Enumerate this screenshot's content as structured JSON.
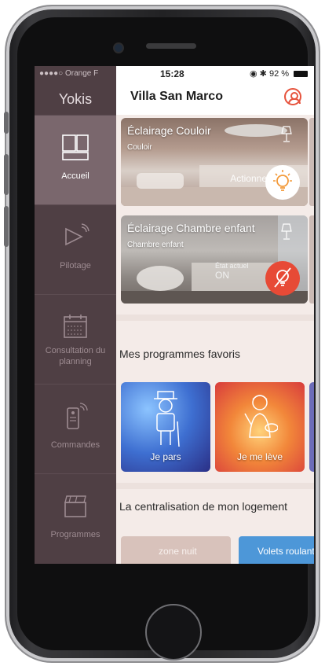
{
  "status_bar": {
    "carrier": "●●●●○ Orange F",
    "time": "15:28",
    "battery": "92 %"
  },
  "sidebar": {
    "brand": "Yokis",
    "items": [
      {
        "label": "Accueil",
        "icon": "home-grid-icon",
        "active": true
      },
      {
        "label": "Pilotage",
        "icon": "play-signal-icon",
        "active": false
      },
      {
        "label": "Consultation du planning",
        "icon": "calendar-icon",
        "active": false
      },
      {
        "label": "Commandes",
        "icon": "remote-icon",
        "active": false
      },
      {
        "label": "Programmes",
        "icon": "clapper-icon",
        "active": false
      }
    ]
  },
  "header": {
    "title": "Villa San Marco",
    "profile_icon": "user-icon"
  },
  "lights": [
    {
      "title": "Éclairage Couloir",
      "room": "Couloir",
      "action": "Actionner",
      "state": "on"
    },
    {
      "title": "Éclairage Chambre enfant",
      "room": "Chambre enfant",
      "state_label": "État actuel",
      "state_value": "ON",
      "state": "off"
    }
  ],
  "favorites": {
    "title": "Mes programmes favoris",
    "items": [
      {
        "label": "Je pars"
      },
      {
        "label": "Je me lève"
      }
    ]
  },
  "centralisation": {
    "title": "La centralisation de mon logement",
    "zones": [
      {
        "label": "zone nuit"
      },
      {
        "label": "Volets roulants"
      }
    ]
  },
  "colors": {
    "sidebar": "#4f3f44",
    "sidebar_active": "#7a676d",
    "accent": "#e6533d"
  }
}
